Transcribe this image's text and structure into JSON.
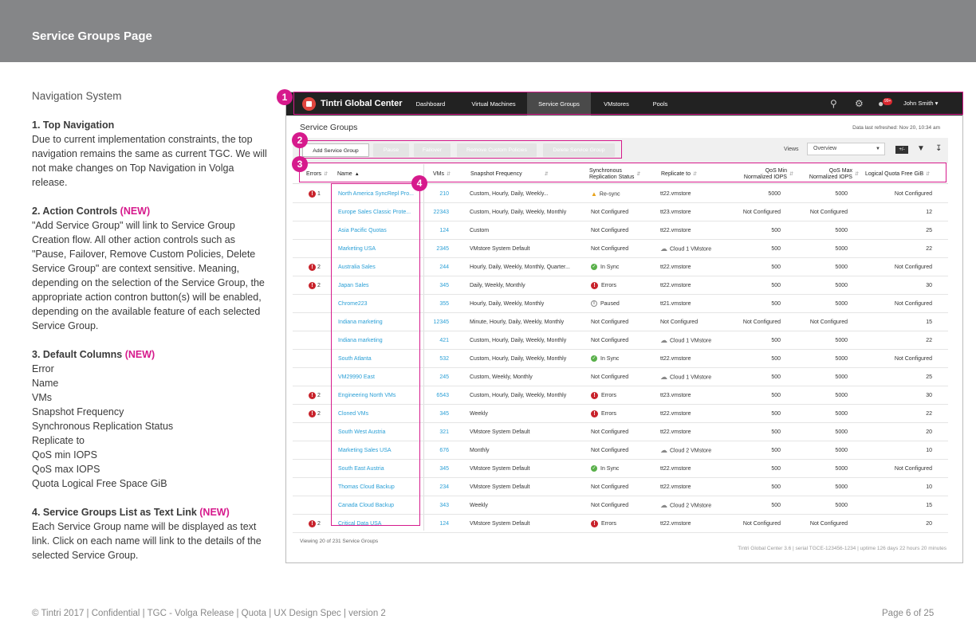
{
  "page": {
    "title": "Service Groups Page"
  },
  "spec": {
    "nav_title": "Navigation System",
    "sections": [
      {
        "heading": "1. Top Navigation",
        "new": "",
        "body": "Due to current implementation constraints, the top navigation remains the same as current TGC. We will not make changes on Top Navigation in Volga release."
      },
      {
        "heading": "2. Action Controls ",
        "new": "(NEW)",
        "body": "\"Add Service Group\" will link to Service Group Creation flow. All other action controls such as \"Pause, Failover, Remove Custom Policies, Delete Service Group\" are context sensitive. Meaning, depending on the selection of the Service Group, the appropriate action contron button(s) will be enabled, depending on the available feature of each selected Service Group."
      },
      {
        "heading": "3. Default Columns ",
        "new": "(NEW)",
        "body": ""
      },
      {
        "heading": "4. Service Groups List as Text Link ",
        "new": "(NEW)",
        "body": "Each Service Group name will be displayed as text link. Click on each name will link to the details of the selected Service Group."
      }
    ],
    "default_columns": [
      "Error",
      "Name",
      "VMs",
      "Snapshot Frequency",
      "Synchronous Replication Status",
      "Replicate to",
      "QoS min IOPS",
      "QoS max IOPS",
      "Quota Logical Free Space GiB"
    ]
  },
  "footer": {
    "left": "© Tintri 2017  | Confidential |  TGC - Volga Release  |  Quota  |  UX Design Spec  |  version 2",
    "right": "Page 6 of 25"
  },
  "app": {
    "brand": "Tintri Global Center",
    "nav": [
      "Dashboard",
      "Virtual Machines",
      "Service Groups",
      "VMstores",
      "Pools"
    ],
    "active_nav": "Service Groups",
    "notifications": "99+",
    "user": "John Smith",
    "page_title": "Service Groups",
    "refreshed": "Data last refreshed: Nov 20, 10:34 am",
    "actions": {
      "add": "Add Service Group",
      "pause": "Pause",
      "failover": "Failover",
      "remove": "Remove Custom Policies",
      "delete": "Delete Service Group"
    },
    "views_label": "Views",
    "views_value": "Overview",
    "columns": {
      "errors": "Errors",
      "name": "Name",
      "vms": "VMs",
      "snapshot": "Snapshot Frequency",
      "sync_1": "Synchronous",
      "sync_2": "Replication Status",
      "replicate": "Replicate to",
      "qosmin_1": "QoS Min",
      "qosmin_2": "Normalized IOPS",
      "qosmax_1": "QoS Max",
      "qosmax_2": "Normalized IOPS",
      "quota": "Logical Quota Free GiB"
    },
    "rows": [
      {
        "err": "1",
        "name": "North America SyncRepl Pro...",
        "vms": "210",
        "snap": "Custom, Hourly, Daily, Weekly...",
        "sync": "Re-sync",
        "sync_type": "warn",
        "rep": "tt22.vmstore",
        "rep_type": "text",
        "qmin": "5000",
        "qmax": "5000",
        "quota": "Not Configured"
      },
      {
        "err": "",
        "name": "Europe Sales Classic Prote...",
        "vms": "22343",
        "snap": "Custom, Hourly, Daily, Weekly, Monthly",
        "sync": "Not Configured",
        "sync_type": "text",
        "rep": "tt23.vmstore",
        "rep_type": "text",
        "qmin": "Not Configured",
        "qmax": "Not Configured",
        "quota": "12"
      },
      {
        "err": "",
        "name": "Asia Pacific Quotas",
        "vms": "124",
        "snap": "Custom",
        "sync": "Not Configured",
        "sync_type": "text",
        "rep": "tt22.vmstore",
        "rep_type": "text",
        "qmin": "500",
        "qmax": "5000",
        "quota": "25"
      },
      {
        "err": "",
        "name": "Marketing USA",
        "vms": "2345",
        "snap": "VMstore System Default",
        "sync": "Not Configured",
        "sync_type": "text",
        "rep": "Cloud  1 VMstore",
        "rep_type": "cloud",
        "qmin": "500",
        "qmax": "5000",
        "quota": "22"
      },
      {
        "err": "2",
        "name": "Australia Sales",
        "vms": "244",
        "snap": "Hourly, Daily, Weekly, Monthly,  Quarter...",
        "sync": "In Sync",
        "sync_type": "ok",
        "rep": "tt22.vmstore",
        "rep_type": "text",
        "qmin": "500",
        "qmax": "5000",
        "quota": "Not Configured"
      },
      {
        "err": "2",
        "name": "Japan Sales",
        "vms": "345",
        "snap": "Daily, Weekly, Monthly",
        "sync": "Errors",
        "sync_type": "err",
        "rep": "tt22.vmstore",
        "rep_type": "text",
        "qmin": "500",
        "qmax": "5000",
        "quota": "30"
      },
      {
        "err": "",
        "name": "Chrome223",
        "vms": "355",
        "snap": "Hourly, Daily, Weekly, Monthly",
        "sync": "Paused",
        "sync_type": "paused",
        "rep": "tt21.vmstore",
        "rep_type": "text",
        "qmin": "500",
        "qmax": "5000",
        "quota": "Not Configured"
      },
      {
        "err": "",
        "name": "Indiana marketing",
        "vms": "12345",
        "snap": "Minute, Hourly, Daily, Weekly, Monthly",
        "sync": "Not Configured",
        "sync_type": "text",
        "rep": "Not Configured",
        "rep_type": "text",
        "qmin": "Not Configured",
        "qmax": "Not Configured",
        "quota": "15"
      },
      {
        "err": "",
        "name": "Indiana marketing",
        "vms": "421",
        "snap": "Custom, Hourly, Daily, Weekly, Monthly",
        "sync": "Not Configured",
        "sync_type": "text",
        "rep": "Cloud  1 VMstore",
        "rep_type": "cloud",
        "qmin": "500",
        "qmax": "5000",
        "quota": "22"
      },
      {
        "err": "",
        "name": "South Atlanta",
        "vms": "532",
        "snap": "Custom, Hourly, Daily, Weekly, Monthly",
        "sync": "In Sync",
        "sync_type": "ok",
        "rep": "tt22.vmstore",
        "rep_type": "text",
        "qmin": "500",
        "qmax": "5000",
        "quota": "Not Configured"
      },
      {
        "err": "",
        "name": "VM29990 East",
        "vms": "245",
        "snap": "Custom, Weekly, Monthly",
        "sync": "Not Configured",
        "sync_type": "text",
        "rep": "Cloud  1 VMstore",
        "rep_type": "cloud",
        "qmin": "500",
        "qmax": "5000",
        "quota": "25"
      },
      {
        "err": "2",
        "name": "Engineering North VMs",
        "vms": "6543",
        "snap": "Custom, Hourly, Daily, Weekly, Monthly",
        "sync": "Errors",
        "sync_type": "err",
        "rep": "tt23.vmstore",
        "rep_type": "text",
        "qmin": "500",
        "qmax": "5000",
        "quota": "30"
      },
      {
        "err": "2",
        "name": "Cloned VMs",
        "vms": "345",
        "snap": "Weekly",
        "sync": "Errors",
        "sync_type": "err",
        "rep": "tt22.vmstore",
        "rep_type": "text",
        "qmin": "500",
        "qmax": "5000",
        "quota": "22"
      },
      {
        "err": "",
        "name": "South West Austria",
        "vms": "321",
        "snap": "VMstore System Default",
        "sync": "Not Configured",
        "sync_type": "text",
        "rep": "tt22.vmstore",
        "rep_type": "text",
        "qmin": "500",
        "qmax": "5000",
        "quota": "20"
      },
      {
        "err": "",
        "name": "Marketing Sales USA",
        "vms": "676",
        "snap": "Monthly",
        "sync": "Not Configured",
        "sync_type": "text",
        "rep": "Cloud  2 VMstore",
        "rep_type": "cloud",
        "qmin": "500",
        "qmax": "5000",
        "quota": "10"
      },
      {
        "err": "",
        "name": "South East Austria",
        "vms": "345",
        "snap": "VMstore System Default",
        "sync": "In Sync",
        "sync_type": "ok",
        "rep": "tt22.vmstore",
        "rep_type": "text",
        "qmin": "500",
        "qmax": "5000",
        "quota": "Not Configured"
      },
      {
        "err": "",
        "name": "Thomas Cloud Backup",
        "vms": "234",
        "snap": "VMstore System Default",
        "sync": "Not Configured",
        "sync_type": "text",
        "rep": "tt22.vmstore",
        "rep_type": "text",
        "qmin": "500",
        "qmax": "5000",
        "quota": "10"
      },
      {
        "err": "",
        "name": "Canada Cloud Backup",
        "vms": "343",
        "snap": "Weekly",
        "sync": "Not Configured",
        "sync_type": "text",
        "rep": "Cloud  2 VMstore",
        "rep_type": "cloud",
        "qmin": "500",
        "qmax": "5000",
        "quota": "15"
      },
      {
        "err": "2",
        "name": "Critical Data USA",
        "vms": "124",
        "snap": "VMstore System Default",
        "sync": "Errors",
        "sync_type": "err",
        "rep": "tt22.vmstore",
        "rep_type": "text",
        "qmin": "Not Configured",
        "qmax": "Not Configured",
        "quota": "20"
      }
    ],
    "grid_footer": "Viewing 20 of 231 Service Groups",
    "app_footer": "Tintri Global Center 3.6   |   serial TGCE-123456-1234   |   uptime 126 days 22 hours 20 minutes"
  },
  "markers": [
    "1",
    "2",
    "3",
    "4"
  ],
  "colors": {
    "accent": "#d61a8c",
    "link": "#2a9fd6",
    "header": "#858688",
    "nav": "#222222",
    "error": "#c8222b",
    "ok": "#59b04a",
    "warn": "#e8a21a"
  }
}
